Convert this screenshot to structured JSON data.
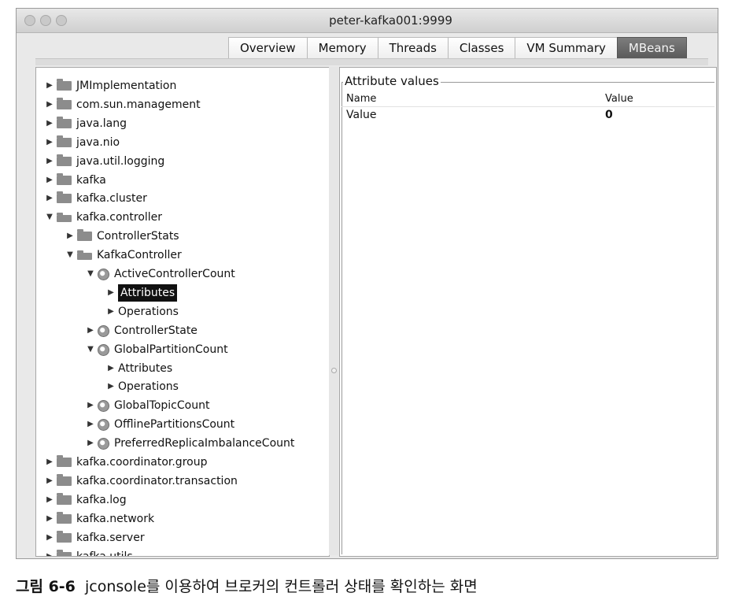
{
  "window": {
    "title": "peter-kafka001:9999"
  },
  "tabs": [
    {
      "label": "Overview",
      "active": false
    },
    {
      "label": "Memory",
      "active": false
    },
    {
      "label": "Threads",
      "active": false
    },
    {
      "label": "Classes",
      "active": false
    },
    {
      "label": "VM Summary",
      "active": false
    },
    {
      "label": "MBeans",
      "active": true
    }
  ],
  "tree": [
    {
      "label": "JMImplementation",
      "icon": "folder-icon",
      "expanded": false
    },
    {
      "label": "com.sun.management",
      "icon": "folder-icon",
      "expanded": false
    },
    {
      "label": "java.lang",
      "icon": "folder-icon",
      "expanded": false
    },
    {
      "label": "java.nio",
      "icon": "folder-icon",
      "expanded": false
    },
    {
      "label": "java.util.logging",
      "icon": "folder-icon",
      "expanded": false
    },
    {
      "label": "kafka",
      "icon": "folder-icon",
      "expanded": false
    },
    {
      "label": "kafka.cluster",
      "icon": "folder-icon",
      "expanded": false
    },
    {
      "label": "kafka.controller",
      "icon": "folder-icon",
      "expanded": true
    },
    {
      "label": "ControllerStats",
      "icon": "folder-icon",
      "expanded": false
    },
    {
      "label": "KafkaController",
      "icon": "folder-icon",
      "expanded": true
    },
    {
      "label": "ActiveControllerCount",
      "icon": "bean-icon",
      "expanded": true
    },
    {
      "label": "Attributes",
      "icon": "none",
      "expanded": false,
      "selected": true
    },
    {
      "label": "Operations",
      "icon": "none",
      "expanded": false
    },
    {
      "label": "ControllerState",
      "icon": "bean-icon",
      "expanded": false
    },
    {
      "label": "GlobalPartitionCount",
      "icon": "bean-icon",
      "expanded": true
    },
    {
      "label": "Attributes",
      "icon": "none",
      "expanded": false
    },
    {
      "label": "Operations",
      "icon": "none",
      "expanded": false
    },
    {
      "label": "GlobalTopicCount",
      "icon": "bean-icon",
      "expanded": false
    },
    {
      "label": "OfflinePartitionsCount",
      "icon": "bean-icon",
      "expanded": false
    },
    {
      "label": "PreferredReplicaImbalanceCount",
      "icon": "bean-icon",
      "expanded": false
    },
    {
      "label": "kafka.coordinator.group",
      "icon": "folder-icon",
      "expanded": false
    },
    {
      "label": "kafka.coordinator.transaction",
      "icon": "folder-icon",
      "expanded": false
    },
    {
      "label": "kafka.log",
      "icon": "folder-icon",
      "expanded": false
    },
    {
      "label": "kafka.network",
      "icon": "folder-icon",
      "expanded": false
    },
    {
      "label": "kafka.server",
      "icon": "folder-icon",
      "expanded": false
    },
    {
      "label": "kafka.utils",
      "icon": "folder-icon",
      "expanded": false
    }
  ],
  "attributes": {
    "group_title": "Attribute values",
    "column_name": "Name",
    "column_value": "Value",
    "row_name": "Value",
    "row_value": "0"
  },
  "caption": {
    "figure": "그림 6-6",
    "text": "jconsole를 이용하여 브로커의 컨트롤러 상태를 확인하는 화면"
  }
}
